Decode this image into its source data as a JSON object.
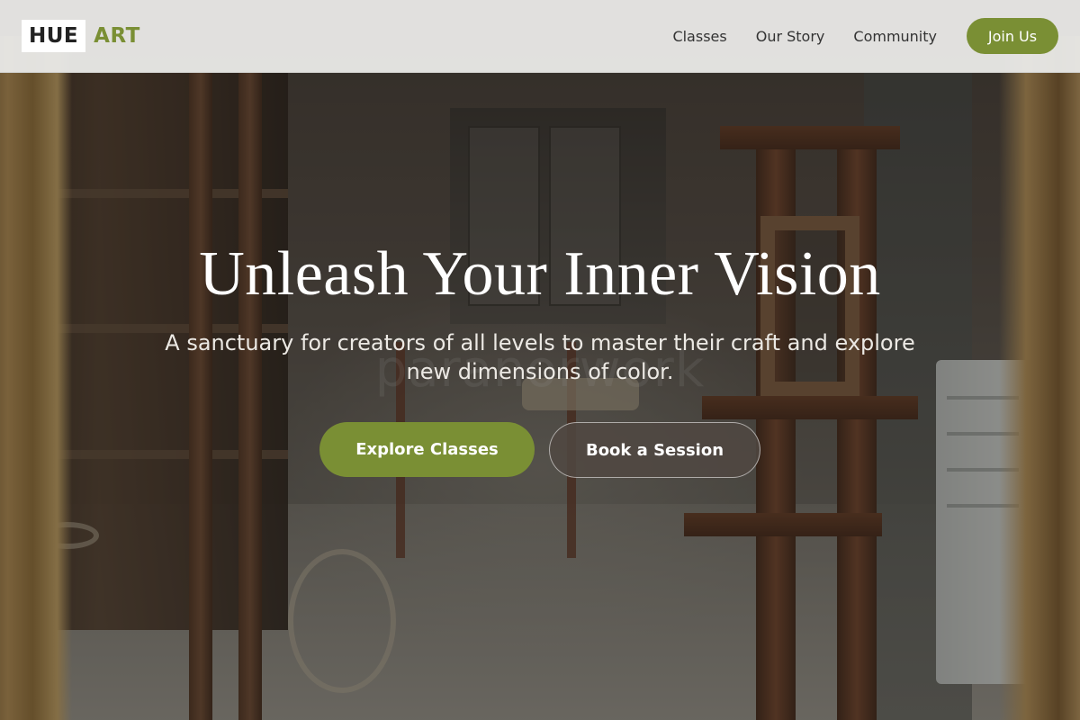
{
  "brand": {
    "logo_primary": "HUE",
    "logo_secondary": "ART",
    "accent_color": "#7a8f34"
  },
  "nav": {
    "items": [
      {
        "label": "Classes"
      },
      {
        "label": "Our Story"
      },
      {
        "label": "Community"
      }
    ],
    "cta_label": "Join Us"
  },
  "hero": {
    "title": "Unleash Your Inner Vision",
    "subtitle": "A sanctuary for creators of all levels to master their craft and explore new dimensions of color.",
    "background_watermark": "paranorwork",
    "primary_button": "Explore Classes",
    "secondary_button": "Book a Session"
  }
}
